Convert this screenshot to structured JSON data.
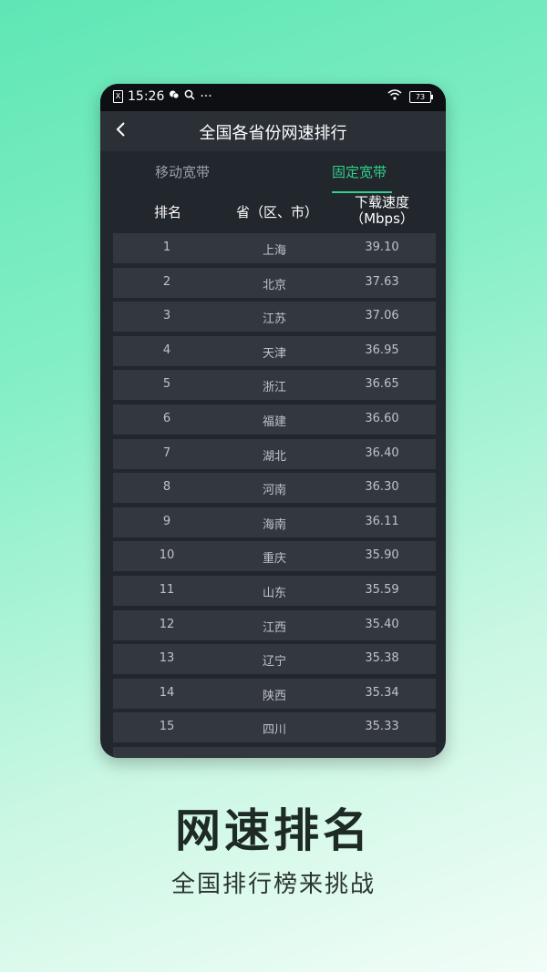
{
  "status": {
    "time": "15:26",
    "battery": "73",
    "sim_label": "X",
    "icons": [
      "wechat-icon",
      "search-icon",
      "more-dots-icon",
      "wifi-icon",
      "battery-icon"
    ],
    "more": "···"
  },
  "nav": {
    "title": "全国各省份网速排行",
    "back_icon": "chevron-left-icon"
  },
  "tabs": [
    {
      "label": "移动宽带",
      "active": false
    },
    {
      "label": "固定宽带",
      "active": true
    }
  ],
  "table": {
    "headers": {
      "rank": "排名",
      "province": "省（区、市）",
      "speed_line1": "下载速度",
      "speed_line2": "（Mbps）"
    },
    "rows": [
      {
        "rank": "1",
        "province": "上海",
        "speed": "39.10"
      },
      {
        "rank": "2",
        "province": "北京",
        "speed": "37.63"
      },
      {
        "rank": "3",
        "province": "江苏",
        "speed": "37.06"
      },
      {
        "rank": "4",
        "province": "天津",
        "speed": "36.95"
      },
      {
        "rank": "5",
        "province": "浙江",
        "speed": "36.65"
      },
      {
        "rank": "6",
        "province": "福建",
        "speed": "36.60"
      },
      {
        "rank": "7",
        "province": "湖北",
        "speed": "36.40"
      },
      {
        "rank": "8",
        "province": "河南",
        "speed": "36.30"
      },
      {
        "rank": "9",
        "province": "海南",
        "speed": "36.11"
      },
      {
        "rank": "10",
        "province": "重庆",
        "speed": "35.90"
      },
      {
        "rank": "11",
        "province": "山东",
        "speed": "35.59"
      },
      {
        "rank": "12",
        "province": "江西",
        "speed": "35.40"
      },
      {
        "rank": "13",
        "province": "辽宁",
        "speed": "35.38"
      },
      {
        "rank": "14",
        "province": "陕西",
        "speed": "35.34"
      },
      {
        "rank": "15",
        "province": "四川",
        "speed": "35.33"
      }
    ]
  },
  "promo": {
    "title": "网速排名",
    "subtitle": "全国排行榜来挑战"
  },
  "colors": {
    "accent": "#2fd28a",
    "panel": "#22262d",
    "row": "#33373e"
  }
}
